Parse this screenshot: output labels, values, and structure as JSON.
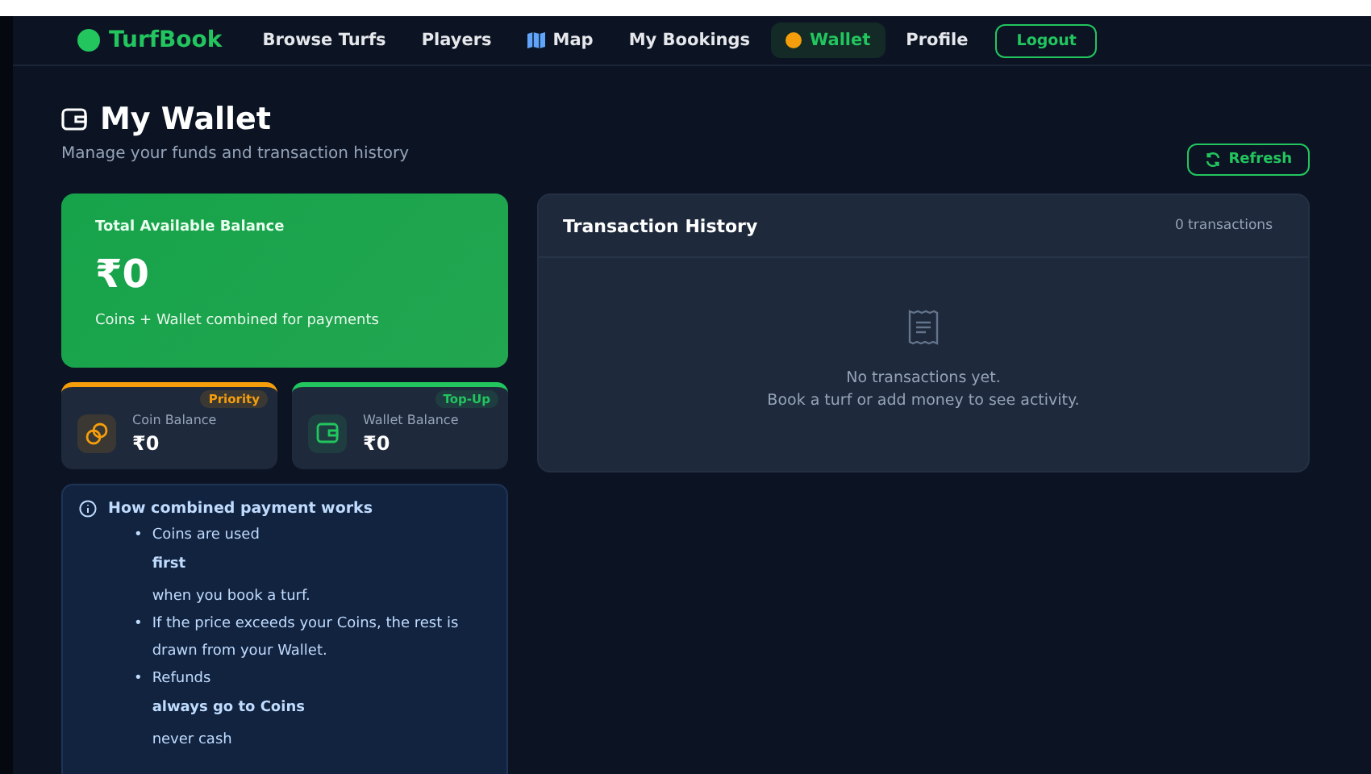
{
  "nav": {
    "brand": "TurfBook",
    "items": [
      {
        "label": "Browse Turfs",
        "kind": "plain",
        "selected": false
      },
      {
        "label": "Players",
        "kind": "plain",
        "selected": false
      },
      {
        "label": "Map",
        "kind": "map",
        "selected": false
      },
      {
        "label": "My Bookings",
        "kind": "plain",
        "selected": false
      },
      {
        "label": "Wallet",
        "kind": "coin",
        "selected": true
      },
      {
        "label": "Profile",
        "kind": "plain",
        "selected": false
      }
    ],
    "logout": "Logout"
  },
  "header": {
    "title": "My Wallet",
    "subtitle": "Manage your funds and transaction history",
    "refresh": "Refresh"
  },
  "total": {
    "label": "Total Available Balance",
    "amount": "₹0",
    "note": "Coins + Wallet combined for payments"
  },
  "balances": [
    {
      "kind": "coin",
      "label": "Coin Balance",
      "badge": "Priority",
      "amount": "₹0",
      "color": "#f59e0b"
    },
    {
      "kind": "wallet",
      "label": "Wallet Balance",
      "badge": "Top-Up",
      "amount": "₹0",
      "color": "#22c55e"
    }
  ],
  "info": {
    "title": "How combined payment works",
    "points": [
      {
        "marker": "•",
        "text": "Coins are used **first** when you book a turf."
      },
      {
        "marker": "•",
        "text": "If the price exceeds your Coins, the rest is drawn from your Wallet."
      },
      {
        "marker": "•",
        "text": "Refunds **always go to Coins** never cash"
      }
    ]
  },
  "history": {
    "title": "Transaction History",
    "count": "0 transactions",
    "empty": "No transactions yet.",
    "hint": "Book a turf or add money to see activity."
  }
}
